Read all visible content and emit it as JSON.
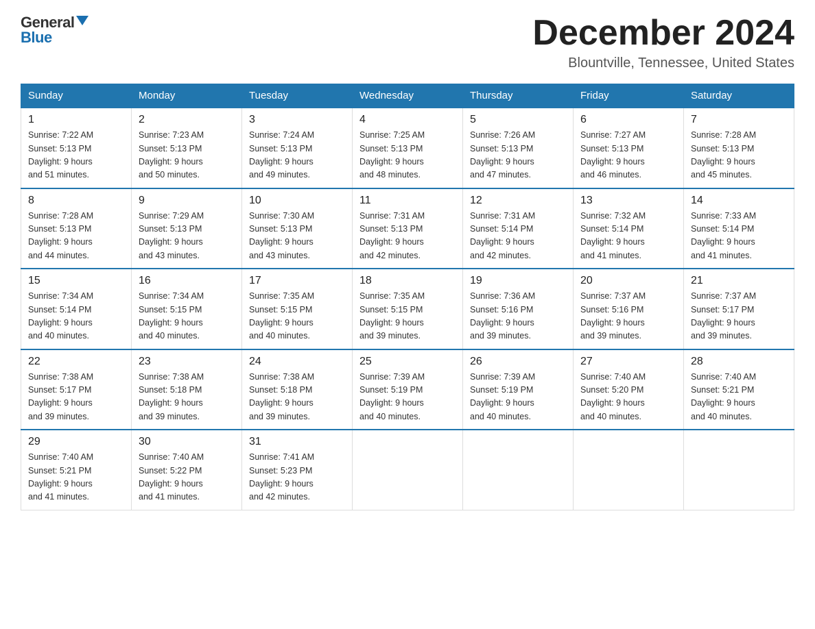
{
  "header": {
    "logo_general": "General",
    "logo_blue": "Blue",
    "title": "December 2024",
    "subtitle": "Blountville, Tennessee, United States"
  },
  "weekdays": [
    "Sunday",
    "Monday",
    "Tuesday",
    "Wednesday",
    "Thursday",
    "Friday",
    "Saturday"
  ],
  "weeks": [
    [
      {
        "day": "1",
        "sunrise": "7:22 AM",
        "sunset": "5:13 PM",
        "daylight": "9 hours and 51 minutes."
      },
      {
        "day": "2",
        "sunrise": "7:23 AM",
        "sunset": "5:13 PM",
        "daylight": "9 hours and 50 minutes."
      },
      {
        "day": "3",
        "sunrise": "7:24 AM",
        "sunset": "5:13 PM",
        "daylight": "9 hours and 49 minutes."
      },
      {
        "day": "4",
        "sunrise": "7:25 AM",
        "sunset": "5:13 PM",
        "daylight": "9 hours and 48 minutes."
      },
      {
        "day": "5",
        "sunrise": "7:26 AM",
        "sunset": "5:13 PM",
        "daylight": "9 hours and 47 minutes."
      },
      {
        "day": "6",
        "sunrise": "7:27 AM",
        "sunset": "5:13 PM",
        "daylight": "9 hours and 46 minutes."
      },
      {
        "day": "7",
        "sunrise": "7:28 AM",
        "sunset": "5:13 PM",
        "daylight": "9 hours and 45 minutes."
      }
    ],
    [
      {
        "day": "8",
        "sunrise": "7:28 AM",
        "sunset": "5:13 PM",
        "daylight": "9 hours and 44 minutes."
      },
      {
        "day": "9",
        "sunrise": "7:29 AM",
        "sunset": "5:13 PM",
        "daylight": "9 hours and 43 minutes."
      },
      {
        "day": "10",
        "sunrise": "7:30 AM",
        "sunset": "5:13 PM",
        "daylight": "9 hours and 43 minutes."
      },
      {
        "day": "11",
        "sunrise": "7:31 AM",
        "sunset": "5:13 PM",
        "daylight": "9 hours and 42 minutes."
      },
      {
        "day": "12",
        "sunrise": "7:31 AM",
        "sunset": "5:14 PM",
        "daylight": "9 hours and 42 minutes."
      },
      {
        "day": "13",
        "sunrise": "7:32 AM",
        "sunset": "5:14 PM",
        "daylight": "9 hours and 41 minutes."
      },
      {
        "day": "14",
        "sunrise": "7:33 AM",
        "sunset": "5:14 PM",
        "daylight": "9 hours and 41 minutes."
      }
    ],
    [
      {
        "day": "15",
        "sunrise": "7:34 AM",
        "sunset": "5:14 PM",
        "daylight": "9 hours and 40 minutes."
      },
      {
        "day": "16",
        "sunrise": "7:34 AM",
        "sunset": "5:15 PM",
        "daylight": "9 hours and 40 minutes."
      },
      {
        "day": "17",
        "sunrise": "7:35 AM",
        "sunset": "5:15 PM",
        "daylight": "9 hours and 40 minutes."
      },
      {
        "day": "18",
        "sunrise": "7:35 AM",
        "sunset": "5:15 PM",
        "daylight": "9 hours and 39 minutes."
      },
      {
        "day": "19",
        "sunrise": "7:36 AM",
        "sunset": "5:16 PM",
        "daylight": "9 hours and 39 minutes."
      },
      {
        "day": "20",
        "sunrise": "7:37 AM",
        "sunset": "5:16 PM",
        "daylight": "9 hours and 39 minutes."
      },
      {
        "day": "21",
        "sunrise": "7:37 AM",
        "sunset": "5:17 PM",
        "daylight": "9 hours and 39 minutes."
      }
    ],
    [
      {
        "day": "22",
        "sunrise": "7:38 AM",
        "sunset": "5:17 PM",
        "daylight": "9 hours and 39 minutes."
      },
      {
        "day": "23",
        "sunrise": "7:38 AM",
        "sunset": "5:18 PM",
        "daylight": "9 hours and 39 minutes."
      },
      {
        "day": "24",
        "sunrise": "7:38 AM",
        "sunset": "5:18 PM",
        "daylight": "9 hours and 39 minutes."
      },
      {
        "day": "25",
        "sunrise": "7:39 AM",
        "sunset": "5:19 PM",
        "daylight": "9 hours and 40 minutes."
      },
      {
        "day": "26",
        "sunrise": "7:39 AM",
        "sunset": "5:19 PM",
        "daylight": "9 hours and 40 minutes."
      },
      {
        "day": "27",
        "sunrise": "7:40 AM",
        "sunset": "5:20 PM",
        "daylight": "9 hours and 40 minutes."
      },
      {
        "day": "28",
        "sunrise": "7:40 AM",
        "sunset": "5:21 PM",
        "daylight": "9 hours and 40 minutes."
      }
    ],
    [
      {
        "day": "29",
        "sunrise": "7:40 AM",
        "sunset": "5:21 PM",
        "daylight": "9 hours and 41 minutes."
      },
      {
        "day": "30",
        "sunrise": "7:40 AM",
        "sunset": "5:22 PM",
        "daylight": "9 hours and 41 minutes."
      },
      {
        "day": "31",
        "sunrise": "7:41 AM",
        "sunset": "5:23 PM",
        "daylight": "9 hours and 42 minutes."
      },
      null,
      null,
      null,
      null
    ]
  ],
  "labels": {
    "sunrise_prefix": "Sunrise: ",
    "sunset_prefix": "Sunset: ",
    "daylight_prefix": "Daylight: "
  }
}
